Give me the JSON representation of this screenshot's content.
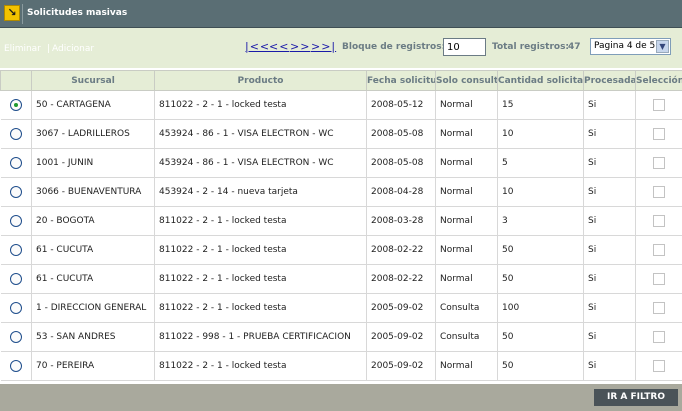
{
  "header": {
    "title": "Solicitudes masivas",
    "icon": "arrow-corner-icon"
  },
  "toolbar": {
    "delete_label": "Eliminar",
    "separator": "|",
    "add_label": "Adicionar",
    "first_label": "|<<",
    "prev_label": "<<",
    "next_label": ">>",
    "last_label": ">>|",
    "block_label": "Bloque de registros:",
    "block_value": "10",
    "total_label": "Total registros:",
    "total_value": "47",
    "page_select": "Pagina 4 de 5"
  },
  "table": {
    "columns": [
      "",
      "Sucursal",
      "Producto",
      "Fecha solicitud",
      "Solo consulta",
      "Cantidad solicitada",
      "Procesada",
      "Selección"
    ],
    "rows": [
      {
        "selected": true,
        "sucursal": "50 - CARTAGENA",
        "producto": "811022 - 2 - 1 - locked testa",
        "fecha": "2008-05-12",
        "solo_consulta": "Normal",
        "cantidad": "15",
        "procesada": "Si"
      },
      {
        "selected": false,
        "sucursal": "3067 - LADRILLEROS",
        "producto": "453924 - 86 - 1 - VISA ELECTRON - WC",
        "fecha": "2008-05-08",
        "solo_consulta": "Normal",
        "cantidad": "10",
        "procesada": "Si"
      },
      {
        "selected": false,
        "sucursal": "1001 - JUNIN",
        "producto": "453924 - 86 - 1 - VISA ELECTRON - WC",
        "fecha": "2008-05-08",
        "solo_consulta": "Normal",
        "cantidad": "5",
        "procesada": "Si"
      },
      {
        "selected": false,
        "sucursal": "3066 - BUENAVENTURA",
        "producto": "453924 - 2 - 14 - nueva tarjeta",
        "fecha": "2008-04-28",
        "solo_consulta": "Normal",
        "cantidad": "10",
        "procesada": "Si"
      },
      {
        "selected": false,
        "sucursal": "20 - BOGOTA",
        "producto": "811022 - 2 - 1 - locked testa",
        "fecha": "2008-03-28",
        "solo_consulta": "Normal",
        "cantidad": "3",
        "procesada": "Si"
      },
      {
        "selected": false,
        "sucursal": "61 - CUCUTA",
        "producto": "811022 - 2 - 1 - locked testa",
        "fecha": "2008-02-22",
        "solo_consulta": "Normal",
        "cantidad": "50",
        "procesada": "Si"
      },
      {
        "selected": false,
        "sucursal": "61 - CUCUTA",
        "producto": "811022 - 2 - 1 - locked testa",
        "fecha": "2008-02-22",
        "solo_consulta": "Normal",
        "cantidad": "50",
        "procesada": "Si"
      },
      {
        "selected": false,
        "sucursal": "1 - DIRECCION GENERAL",
        "producto": "811022 - 2 - 1 - locked testa",
        "fecha": "2005-09-02",
        "solo_consulta": "Consulta",
        "cantidad": "100",
        "procesada": "Si"
      },
      {
        "selected": false,
        "sucursal": "53 - SAN ANDRES",
        "producto": "811022 - 998 - 1 - PRUEBA CERTIFICACION",
        "fecha": "2005-09-02",
        "solo_consulta": "Consulta",
        "cantidad": "50",
        "procesada": "Si"
      },
      {
        "selected": false,
        "sucursal": "70 - PEREIRA",
        "producto": "811022 - 2 - 1 - locked testa",
        "fecha": "2005-09-02",
        "solo_consulta": "Normal",
        "cantidad": "50",
        "procesada": "Si"
      }
    ]
  },
  "footer": {
    "filter_label": "IR A FILTRO"
  },
  "colors": {
    "header_bg": "#5a6e74",
    "toolbar_bg": "#e5edd6",
    "pager_link": "#1a1aa8",
    "footer_bg": "#a9a99d",
    "button_bg": "#4a5358"
  }
}
